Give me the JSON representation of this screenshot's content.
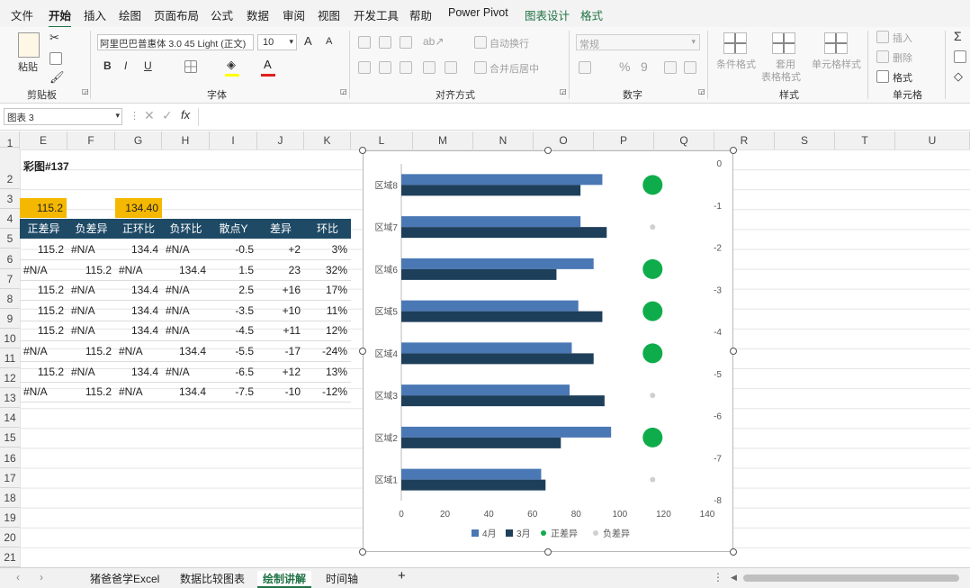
{
  "ribbon_tabs": [
    "文件",
    "开始",
    "插入",
    "绘图",
    "页面布局",
    "公式",
    "数据",
    "审阅",
    "视图",
    "开发工具",
    "帮助",
    "Power Pivot",
    "图表设计",
    "格式"
  ],
  "ribbon": {
    "clipboard": {
      "paste": "粘贴",
      "label": "剪贴板"
    },
    "font": {
      "name": "阿里巴巴普惠体 3.0 45 Light (正文)",
      "size": "10",
      "label": "字体",
      "bold": "B",
      "italic": "I",
      "underline": "U",
      "grow": "A",
      "shrink": "A"
    },
    "alignment": {
      "wrap": "自动换行",
      "merge": "合并后居中",
      "label": "对齐方式"
    },
    "number": {
      "format": "常规",
      "percent": "%",
      "comma": "9",
      "label": "数字"
    },
    "styles": {
      "conditional": "条件格式",
      "table_line1": "套用",
      "table_line2": "表格格式",
      "cell_styles": "单元格样式",
      "label": "样式"
    },
    "cells": {
      "insert": "插入",
      "delete": "删除",
      "format": "格式",
      "label": "单元格"
    }
  },
  "formula_bar": {
    "name_box": "图表 3",
    "fx": "fx",
    "formula": ""
  },
  "columns": [
    "E",
    "F",
    "G",
    "H",
    "I",
    "J",
    "K",
    "L",
    "M",
    "N",
    "O",
    "P",
    "Q",
    "R",
    "S",
    "T",
    "U"
  ],
  "rows": [
    "1",
    "2",
    "3",
    "4",
    "5",
    "6",
    "7",
    "8",
    "9",
    "10",
    "11",
    "12",
    "13",
    "14",
    "15",
    "16",
    "17",
    "18",
    "19",
    "20",
    "21"
  ],
  "sheet": {
    "title": "彩图#137",
    "yellow_e": "115.2",
    "yellow_g": "134.40",
    "headers": [
      "正差异",
      "负差异",
      "正环比",
      "负环比",
      "散点Y",
      "差异",
      "环比"
    ],
    "data": [
      [
        "115.2",
        "#N/A",
        "134.4",
        "#N/A",
        "-0.5",
        "+2",
        "3%"
      ],
      [
        "#N/A",
        "115.2",
        "#N/A",
        "134.4",
        "1.5",
        "23",
        "32%"
      ],
      [
        "115.2",
        "#N/A",
        "134.4",
        "#N/A",
        "2.5",
        "+16",
        "17%"
      ],
      [
        "115.2",
        "#N/A",
        "134.4",
        "#N/A",
        "-3.5",
        "+10",
        "11%"
      ],
      [
        "115.2",
        "#N/A",
        "134.4",
        "#N/A",
        "-4.5",
        "+11",
        "12%"
      ],
      [
        "#N/A",
        "115.2",
        "#N/A",
        "134.4",
        "-5.5",
        "-17",
        "-24%"
      ],
      [
        "115.2",
        "#N/A",
        "134.4",
        "#N/A",
        "-6.5",
        "+12",
        "13%"
      ],
      [
        "#N/A",
        "115.2",
        "#N/A",
        "134.4",
        "-7.5",
        "-10",
        "-12%"
      ]
    ]
  },
  "chart_data": {
    "type": "bar",
    "categories": [
      "区域8",
      "区域7",
      "区域6",
      "区域5",
      "区域4",
      "区域3",
      "区域2",
      "区域1"
    ],
    "series": [
      {
        "name": "4月",
        "color": "#4a78b5",
        "values": [
          92,
          82,
          88,
          81,
          78,
          77,
          96,
          64
        ]
      },
      {
        "name": "3月",
        "color": "#1e3f5a",
        "values": [
          82,
          94,
          71,
          92,
          88,
          93,
          73,
          66
        ]
      }
    ],
    "scatter": [
      {
        "name": "正差异",
        "color": "#0fac4b",
        "x": 115,
        "y": [
          -0.5,
          -2.5,
          -3.5,
          -4.5,
          -6.5
        ]
      },
      {
        "name": "负差异",
        "color": "#d0d0d0",
        "x": 115,
        "y": [
          -1.5,
          -5.5,
          -7.5
        ]
      }
    ],
    "xaxis": {
      "ticks": [
        "0",
        "20",
        "40",
        "60",
        "80",
        "100",
        "120",
        "140"
      ],
      "min": 0,
      "max": 140
    },
    "y2axis": {
      "ticks": [
        "0",
        "-1",
        "-2",
        "-3",
        "-4",
        "-5",
        "-6",
        "-7",
        "-8"
      ],
      "min": -8,
      "max": 0
    },
    "legend": [
      "4月",
      "3月",
      "正差异",
      "负差异"
    ],
    "legend_position": "bottom"
  },
  "sheet_tabs": [
    "猪爸爸学Excel",
    "数据比较图表",
    "绘制讲解",
    "时间轴"
  ],
  "active_sheet": "绘制讲解",
  "add_sheet": "+",
  "nav": {
    "prev": "‹",
    "next": "›",
    "more": "⋮"
  }
}
